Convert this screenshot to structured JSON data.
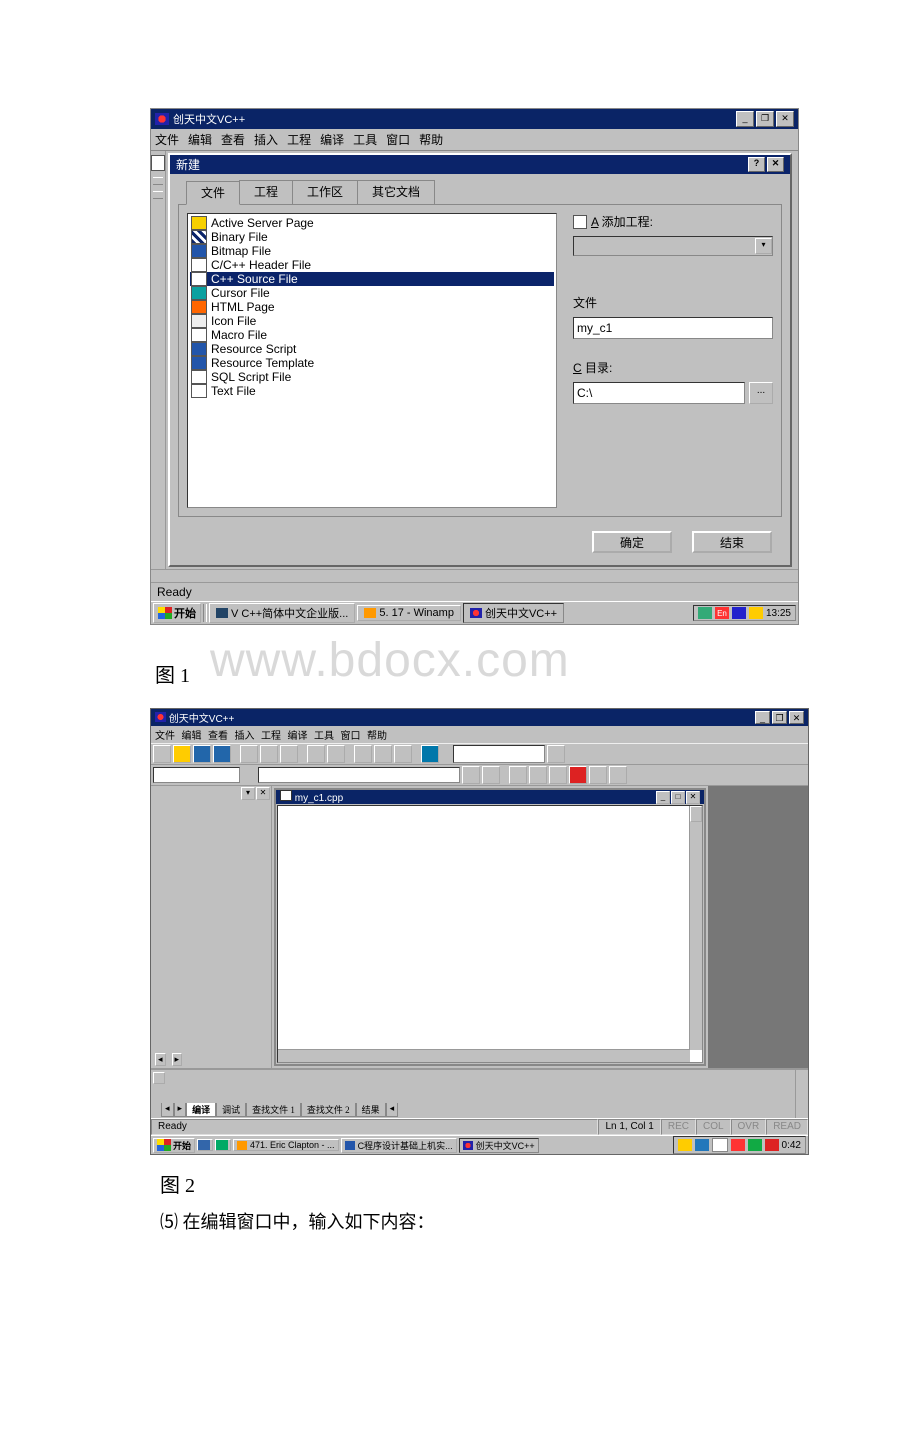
{
  "fig1": {
    "title": "创天中文VC++",
    "menus": [
      "文件",
      "编辑",
      "查看",
      "插入",
      "工程",
      "编译",
      "工具",
      "窗口",
      "帮助"
    ],
    "dialog": {
      "title": "新建",
      "tabs": {
        "t1": "文件",
        "t2": "工程",
        "t3": "工作区",
        "t4": "其它文档"
      },
      "list": [
        "Active Server Page",
        "Binary File",
        "Bitmap File",
        "C/C++ Header File",
        "C++ Source File",
        "Cursor File",
        "HTML Page",
        "Icon File",
        "Macro File",
        "Resource Script",
        "Resource Template",
        "SQL Script File",
        "Text File"
      ],
      "add_label": "A 添加工程:",
      "file_label": "文件",
      "file_value": "my_c1",
      "dir_label": "C 目录:",
      "dir_value": "C:\\",
      "ok": "确定",
      "end": "结束"
    },
    "status": "Ready",
    "taskbar": {
      "start": "开始",
      "b1": "V C++简体中文企业版...",
      "b2": "5. 17 - Winamp",
      "b3": "创天中文VC++",
      "clock": "13:25"
    }
  },
  "caption1": "图 1",
  "watermark": "www.bdocx.com",
  "fig2": {
    "title": "创天中文VC++",
    "menus": [
      "文件",
      "编辑",
      "查看",
      "插入",
      "工程",
      "编译",
      "工具",
      "窗口",
      "帮助"
    ],
    "editor_title": "my_c1.cpp",
    "output_tabs": {
      "t1": "编译",
      "t2": "调试",
      "t3": "查找文件 1",
      "t4": "查找文件 2",
      "t5": "结果"
    },
    "status": {
      "ready": "Ready",
      "pos": "Ln 1, Col 1",
      "s1": "REC",
      "s2": "COL",
      "s3": "OVR",
      "s4": "READ"
    },
    "taskbar": {
      "start": "开始",
      "b1": "471. Eric Clapton - ...",
      "b2": "C程序设计基础上机实...",
      "b3": "创天中文VC++",
      "clock": "0:42"
    }
  },
  "caption2": "图 2",
  "instruction": "⑸ 在编辑窗口中，输入如下内容："
}
